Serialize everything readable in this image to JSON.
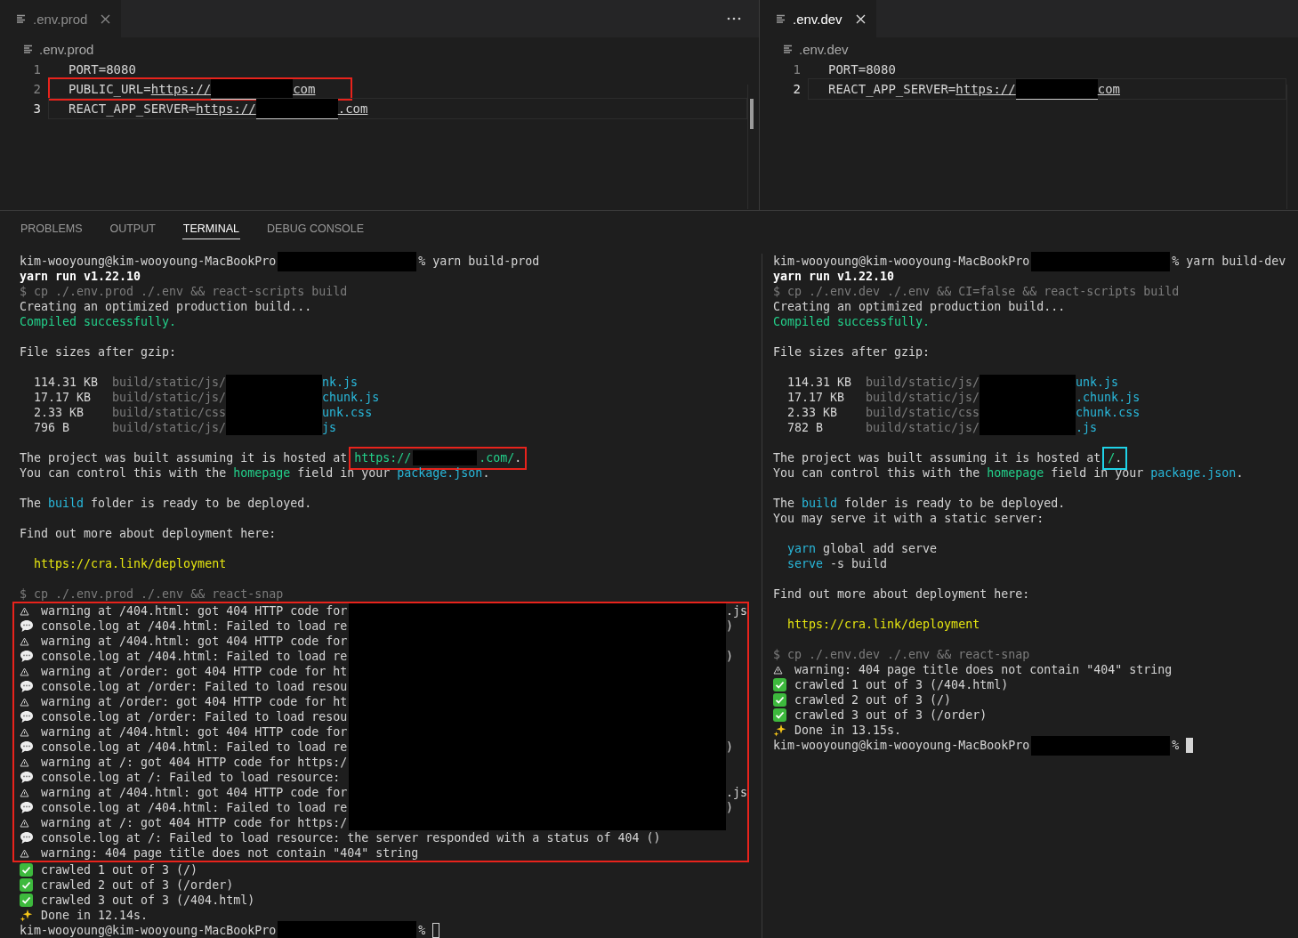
{
  "editor_panes": [
    {
      "tab": {
        "label": ".env.prod",
        "active": false
      },
      "actions_menu": true,
      "ruler_marker": true,
      "breadcrumb": ".env.prod",
      "lines": [
        {
          "number": "1",
          "current": false,
          "segments": [
            {
              "kind": "plain",
              "text": "PORT=8080"
            }
          ]
        },
        {
          "number": "2",
          "current": false,
          "color": "#e8231c",
          "segments": [
            {
              "kind": "plain",
              "text": "PUBLIC_URL="
            },
            {
              "kind": "link",
              "text": "https://"
            },
            {
              "kind": "mask"
            },
            {
              "kind": "link",
              "text": "com"
            }
          ]
        },
        {
          "number": "3",
          "current": true,
          "segments": [
            {
              "kind": "plain",
              "text": "REACT_APP_SERVER="
            },
            {
              "kind": "link",
              "text": "https://"
            },
            {
              "kind": "mask"
            },
            {
              "kind": "link",
              "text": ".com"
            }
          ]
        }
      ]
    },
    {
      "tab": {
        "label": ".env.dev",
        "active": true
      },
      "actions_menu": false,
      "ruler_marker": false,
      "breadcrumb": ".env.dev",
      "lines": [
        {
          "number": "1",
          "current": false,
          "segments": [
            {
              "kind": "plain",
              "text": "PORT=8080"
            }
          ]
        },
        {
          "number": "2",
          "current": true,
          "segments": [
            {
              "kind": "plain",
              "text": "REACT_APP_SERVER="
            },
            {
              "kind": "link",
              "text": "https://"
            },
            {
              "kind": "mask"
            },
            {
              "kind": "link",
              "text": "com"
            }
          ]
        }
      ]
    }
  ],
  "panel_tabs": [
    {
      "label": "PROBLEMS",
      "selected": false
    },
    {
      "label": "OUTPUT",
      "selected": false
    },
    {
      "label": "TERMINAL",
      "selected": true
    },
    {
      "label": "DEBUG CONSOLE",
      "selected": false
    }
  ],
  "terminals": [
    {
      "focused": false,
      "lines": [
        {
          "kind": "text",
          "segments": [
            {
              "kind": "plain",
              "text": "kim-wooyoung@kim-wooyoung-MacBookPro"
            },
            {
              "kind": "mask"
            },
            {
              "kind": "plain",
              "text": "% yarn build-prod"
            }
          ]
        },
        {
          "kind": "text",
          "segments": [
            {
              "kind": "bold",
              "text": "yarn run v1.22.10"
            }
          ]
        },
        {
          "kind": "text",
          "segments": [
            {
              "kind": "dim",
              "text": "$ cp ./.env.prod ./.env && react-scripts build"
            }
          ]
        },
        {
          "kind": "text",
          "segments": [
            {
              "kind": "plain",
              "text": "Creating an optimized production build..."
            }
          ]
        },
        {
          "kind": "text",
          "segments": [
            {
              "kind": "green",
              "text": "Compiled successfully."
            }
          ]
        },
        {
          "kind": "blank"
        },
        {
          "kind": "text",
          "segments": [
            {
              "kind": "plain",
              "text": "File sizes after gzip:"
            }
          ]
        },
        {
          "kind": "blank"
        },
        {
          "kind": "file",
          "size": "114.31 KB",
          "path": "build/static/js/",
          "tail": "nk.js"
        },
        {
          "kind": "file",
          "size": "17.17 KB",
          "path": "build/static/js/",
          "tail": "chunk.js"
        },
        {
          "kind": "file",
          "size": "2.33 KB",
          "path": "build/static/css",
          "tail": "unk.css"
        },
        {
          "kind": "file",
          "size": "796 B",
          "path": "build/static/js/",
          "tail": "js"
        },
        {
          "kind": "blank"
        },
        {
          "kind": "text",
          "segments": [
            {
              "kind": "plain",
              "text": "The project was built assuming it is hosted at"
            },
            {
              "kind": "boxed",
              "color": "#e8231c",
              "segments": [
                {
                  "kind": "green",
                  "text": "https://"
                },
                {
                  "kind": "mask"
                },
                {
                  "kind": "green",
                  "text": ".com/"
                },
                {
                  "kind": "plain",
                  "text": "."
                }
              ]
            }
          ]
        },
        {
          "kind": "text",
          "segments": [
            {
              "kind": "plain",
              "text": "You can control this with the "
            },
            {
              "kind": "green",
              "text": "homepage"
            },
            {
              "kind": "plain",
              "text": " field in your "
            },
            {
              "kind": "blue",
              "text": "package.json"
            },
            {
              "kind": "plain",
              "text": "."
            }
          ]
        },
        {
          "kind": "blank"
        },
        {
          "kind": "text",
          "segments": [
            {
              "kind": "plain",
              "text": "The "
            },
            {
              "kind": "blue",
              "text": "build"
            },
            {
              "kind": "plain",
              "text": " folder is ready to be deployed."
            }
          ]
        },
        {
          "kind": "blank"
        },
        {
          "kind": "text",
          "segments": [
            {
              "kind": "plain",
              "text": "Find out more about deployment here:"
            }
          ]
        },
        {
          "kind": "blank"
        },
        {
          "kind": "indented",
          "segments": [
            {
              "kind": "yellow",
              "text": "https://cra.link/deployment"
            }
          ]
        },
        {
          "kind": "blank"
        },
        {
          "kind": "text",
          "segments": [
            {
              "kind": "dim",
              "text": "$ cp ./.env.prod ./.env && react-snap"
            }
          ]
        },
        {
          "kind": "group",
          "color": "#e8231c",
          "rows": [
            {
              "kind": "warning",
              "redacted": true,
              "text": "warning at /404.html: got 404 HTTP code for",
              "tail": ".js"
            },
            {
              "kind": "comment",
              "redacted": true,
              "text": "console.log at /404.html: Failed to load re",
              "tail": ")"
            },
            {
              "kind": "warning",
              "redacted": true,
              "text": "warning at /404.html: got 404 HTTP code for"
            },
            {
              "kind": "comment",
              "redacted": true,
              "text": "console.log at /404.html: Failed to load re",
              "tail": ")"
            },
            {
              "kind": "warning",
              "redacted": true,
              "text": "warning at /order: got 404 HTTP code for ht"
            },
            {
              "kind": "comment",
              "redacted": true,
              "text": "console.log at /order: Failed to load resou"
            },
            {
              "kind": "warning",
              "redacted": true,
              "text": "warning at /order: got 404 HTTP code for ht"
            },
            {
              "kind": "comment",
              "redacted": true,
              "text": "console.log at /order: Failed to load resou"
            },
            {
              "kind": "warning",
              "redacted": true,
              "text": "warning at /404.html: got 404 HTTP code for"
            },
            {
              "kind": "comment",
              "redacted": true,
              "text": "console.log at /404.html: Failed to load re",
              "tail": ")"
            },
            {
              "kind": "warning",
              "redacted": true,
              "text": "warning at /: got 404 HTTP code for https:/"
            },
            {
              "kind": "comment",
              "redacted": true,
              "text": "console.log at /: Failed to load resource:"
            },
            {
              "kind": "warning",
              "redacted": true,
              "text": "warning at /404.html: got 404 HTTP code for",
              "tail": ".js"
            },
            {
              "kind": "comment",
              "redacted": true,
              "text": "console.log at /404.html: Failed to load re",
              "tail": ")"
            },
            {
              "kind": "warning",
              "redacted": true,
              "text": "warning at /: got 404 HTTP code for https:/"
            },
            {
              "kind": "comment",
              "redacted": false,
              "text": "console.log at /: Failed to load resource: the server responded with a status of 404 ()"
            },
            {
              "kind": "warning",
              "redacted": false,
              "text": "warning: 404 page title does not contain \"404\" string"
            }
          ]
        },
        {
          "kind": "check",
          "text": "crawled 1 out of 3 (/)"
        },
        {
          "kind": "check",
          "text": "crawled 2 out of 3 (/order)"
        },
        {
          "kind": "check",
          "text": "crawled 3 out of 3 (/404.html)"
        },
        {
          "kind": "sparkle",
          "text": "Done in 12.14s."
        },
        {
          "kind": "text",
          "cursor": true,
          "segments": [
            {
              "kind": "plain",
              "text": "kim-wooyoung@kim-wooyoung-MacBookPro"
            },
            {
              "kind": "mask"
            },
            {
              "kind": "plain",
              "text": "%"
            }
          ]
        }
      ]
    },
    {
      "focused": true,
      "lines": [
        {
          "kind": "text",
          "segments": [
            {
              "kind": "plain",
              "text": "kim-wooyoung@kim-wooyoung-MacBookPro"
            },
            {
              "kind": "mask"
            },
            {
              "kind": "plain",
              "text": "% yarn build-dev"
            }
          ]
        },
        {
          "kind": "text",
          "segments": [
            {
              "kind": "bold",
              "text": "yarn run v1.22.10"
            }
          ]
        },
        {
          "kind": "text",
          "segments": [
            {
              "kind": "dim",
              "text": "$ cp ./.env.dev ./.env && CI=false && react-scripts build"
            }
          ]
        },
        {
          "kind": "text",
          "segments": [
            {
              "kind": "plain",
              "text": "Creating an optimized production build..."
            }
          ]
        },
        {
          "kind": "text",
          "segments": [
            {
              "kind": "green",
              "text": "Compiled successfully."
            }
          ]
        },
        {
          "kind": "blank"
        },
        {
          "kind": "text",
          "segments": [
            {
              "kind": "plain",
              "text": "File sizes after gzip:"
            }
          ]
        },
        {
          "kind": "blank"
        },
        {
          "kind": "file",
          "size": "114.31 KB",
          "path": "build/static/js/",
          "tail": "unk.js"
        },
        {
          "kind": "file",
          "size": "17.17 KB",
          "path": "build/static/js/",
          "tail": ".chunk.js"
        },
        {
          "kind": "file",
          "size": "2.33 KB",
          "path": "build/static/css",
          "tail": "chunk.css"
        },
        {
          "kind": "file",
          "size": "782 B",
          "path": "build/static/js/",
          "tail": ".js"
        },
        {
          "kind": "blank"
        },
        {
          "kind": "text",
          "segments": [
            {
              "kind": "plain",
              "text": "The project was built assuming it is hosted at"
            },
            {
              "kind": "boxed",
              "color": "#1fd3e8",
              "segments": [
                {
                  "kind": "green",
                  "text": "/"
                },
                {
                  "kind": "plain",
                  "text": "."
                }
              ]
            }
          ]
        },
        {
          "kind": "text",
          "segments": [
            {
              "kind": "plain",
              "text": "You can control this with the "
            },
            {
              "kind": "green",
              "text": "homepage"
            },
            {
              "kind": "plain",
              "text": " field in your "
            },
            {
              "kind": "blue",
              "text": "package.json"
            },
            {
              "kind": "plain",
              "text": "."
            }
          ]
        },
        {
          "kind": "blank"
        },
        {
          "kind": "text",
          "segments": [
            {
              "kind": "plain",
              "text": "The "
            },
            {
              "kind": "blue",
              "text": "build"
            },
            {
              "kind": "plain",
              "text": " folder is ready to be deployed."
            }
          ]
        },
        {
          "kind": "text",
          "segments": [
            {
              "kind": "plain",
              "text": "You may serve it with a static server:"
            }
          ]
        },
        {
          "kind": "blank"
        },
        {
          "kind": "indented",
          "segments": [
            {
              "kind": "blue",
              "text": "yarn"
            },
            {
              "kind": "plain",
              "text": " global add serve"
            }
          ]
        },
        {
          "kind": "indented",
          "segments": [
            {
              "kind": "blue",
              "text": "serve"
            },
            {
              "kind": "plain",
              "text": " -s build"
            }
          ]
        },
        {
          "kind": "blank"
        },
        {
          "kind": "text",
          "segments": [
            {
              "kind": "plain",
              "text": "Find out more about deployment here:"
            }
          ]
        },
        {
          "kind": "blank"
        },
        {
          "kind": "indented",
          "segments": [
            {
              "kind": "yellow",
              "text": "https://cra.link/deployment"
            }
          ]
        },
        {
          "kind": "blank"
        },
        {
          "kind": "text",
          "segments": [
            {
              "kind": "dim",
              "text": "$ cp ./.env.dev ./.env && react-snap"
            }
          ]
        },
        {
          "kind": "warning",
          "text": "warning: 404 page title does not contain \"404\" string"
        },
        {
          "kind": "check",
          "text": "crawled 1 out of 3 (/404.html)"
        },
        {
          "kind": "check",
          "text": "crawled 2 out of 3 (/)"
        },
        {
          "kind": "check",
          "text": "crawled 3 out of 3 (/order)"
        },
        {
          "kind": "sparkle",
          "text": "Done in 13.15s."
        },
        {
          "kind": "text",
          "cursor": true,
          "segments": [
            {
              "kind": "plain",
              "text": "kim-wooyoung@kim-wooyoung-MacBookPro"
            },
            {
              "kind": "mask"
            },
            {
              "kind": "plain",
              "text": "%"
            }
          ]
        }
      ]
    }
  ]
}
